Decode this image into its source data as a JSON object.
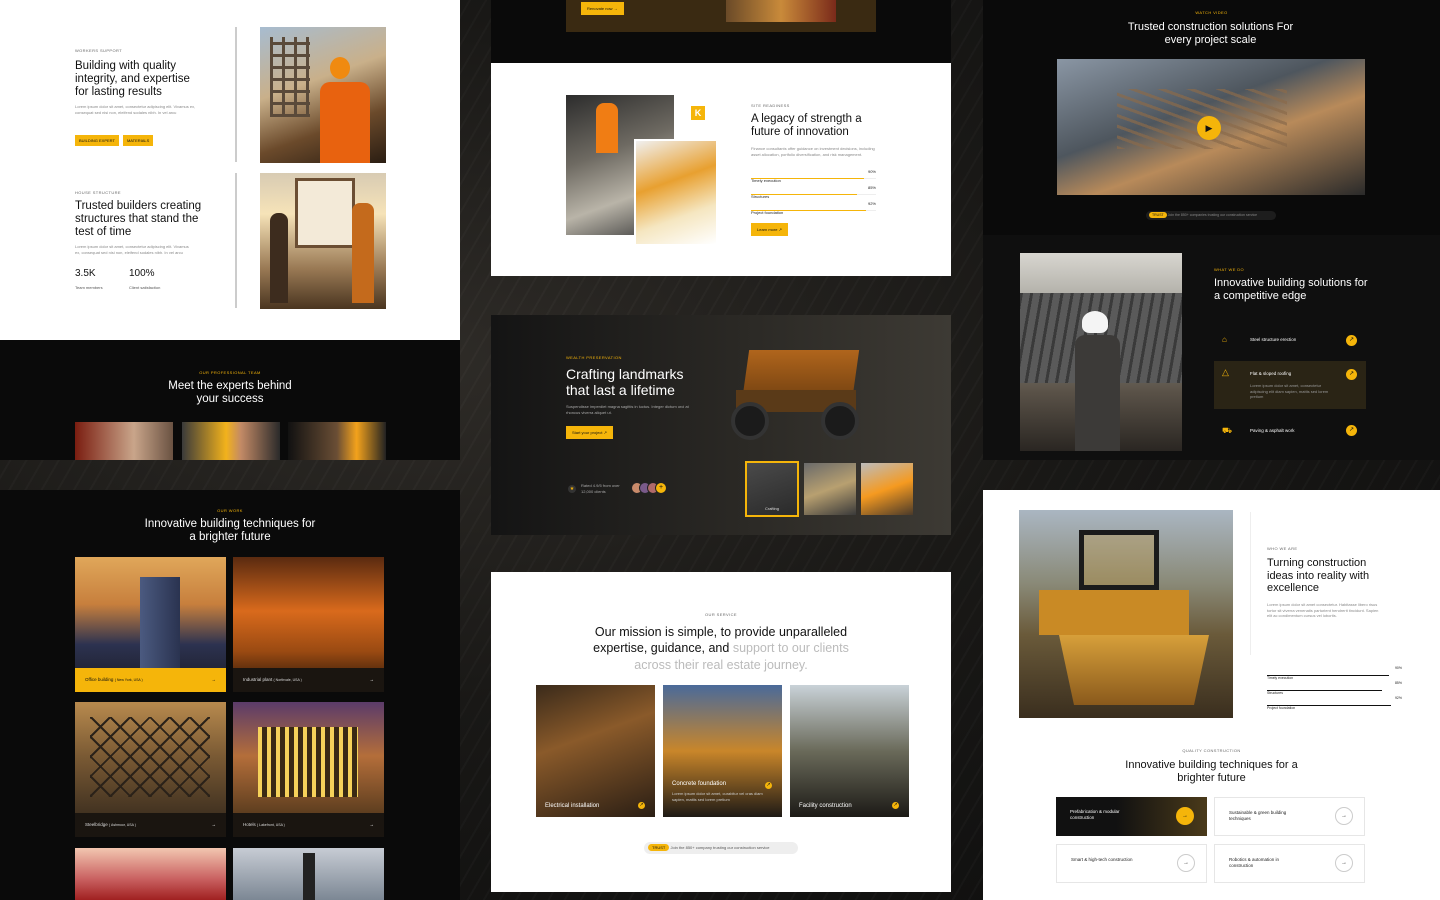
{
  "p1": {
    "tag1": "Workers support",
    "title1": "Building with quality integrity, and expertise for lasting results",
    "body1": "Lorem ipsum dolor sit amet, consectetur adipiscing elit. Vivamus ex, consequat sed nisi non, eleifend sodales nibh. In vel arcu",
    "chip1": "Building expert",
    "chip2": "Materials",
    "tag2": "House structure",
    "title2": "Trusted builders creating structures that stand the test of time",
    "body2": "Lorem ipsum dolor sit amet, consectetur adipiscing elit. Vivamus ex, consequat sed nisi non, eleifend sodales nibh. In vel arcu",
    "stat1_value": "3.5K",
    "stat1_label": "Team members",
    "stat2_value": "100%",
    "stat2_label": "Client satisfaction"
  },
  "p2": {
    "tag": "Our professional team",
    "title": "Meet the experts behind your success"
  },
  "p3": {
    "tag": "Our work",
    "title": "Innovative building techniques for a brighter future",
    "cards": [
      {
        "name": "Office building",
        "loc": "( New York, USA )",
        "arrow": "→"
      },
      {
        "name": "Industrial plant",
        "loc": "( Northvale, USA )",
        "arrow": "→"
      },
      {
        "name": "Steelbridge",
        "loc": "( Ashmoor, USA )",
        "arrow": "→"
      },
      {
        "name": "Hotels",
        "loc": "( Lakefront, USA )",
        "arrow": "→"
      }
    ]
  },
  "p4": {
    "btn": "Renovate now →"
  },
  "p5": {
    "logo": "K",
    "tag": "Site readiness",
    "title": "A legacy of strength a future of innovation",
    "body": "Finance consultants offer guidance on investment decisions, including asset allocation, portfolio diversification, and risk management.",
    "bars": [
      {
        "label": "Timely execution",
        "value": "90%"
      },
      {
        "label": "Structures",
        "value": "85%"
      },
      {
        "label": "Project foundation",
        "value": "92%"
      }
    ],
    "btn": "Learn more ↗"
  },
  "p6": {
    "tag": "Wealth preservation",
    "title": "Crafting landmarks that last a lifetime",
    "body": "Suspendisse imperdiet magna sagittis in luctus. Integer dictum orci at rhoncus viverra aliquet ut.",
    "btn": "Start your project ↗",
    "rating": "Rated 4.9/5 from over 12,000 clients",
    "thumb_label": "Crafting"
  },
  "p7": {
    "tag": "Our service",
    "title_dark": "Our mission is simple, to provide unparalleled expertise, guidance, and",
    "title_light": "support to our clients across their real estate journey.",
    "cards": [
      {
        "name": "Electrical installation"
      },
      {
        "name": "Concrete foundation",
        "body": "Lorem ipsum dolor sit amet, curabitur vel cras diam sapien, mattis sed lorem pretium"
      },
      {
        "name": "Facility construction"
      }
    ],
    "trust_badge": "Trust",
    "trust_text": "Join the 850+ company trusting our construction service"
  },
  "p8": {
    "tag": "Watch video",
    "title": "Trusted construction solutions For every project scale",
    "badge": "Trust",
    "badge_text": "Join the 850+ companies trusting our construction service"
  },
  "p9": {
    "tag": "What we do",
    "title": "Innovative building solutions for a competitive edge",
    "items": [
      {
        "name": "Steel structure erection"
      },
      {
        "name": "Flat & sloped roofing",
        "body": "Lorem ipsum dolor sit amet, consectetur adipiscing elit diam sapien, mattis sed lorem pretium"
      },
      {
        "name": "Paving & asphalt work"
      }
    ]
  },
  "p10": {
    "tag": "Who we are",
    "title": "Turning construction ideas into reality with excellence",
    "body": "Lorem ipsum dolor sit amet consectetur. Habitasse libero risus tortor sit viverra venenatis parturient hendrerit tincidunt. Sapien elit ac condimentum cursus vel lobortis.",
    "bars": [
      {
        "label": "Timely execution",
        "value": "90%"
      },
      {
        "label": "Structures",
        "value": "85%"
      },
      {
        "label": "Project foundation",
        "value": "92%"
      }
    ],
    "tag2": "Quality construction",
    "title2": "Innovative building techniques for a brighter future",
    "tiles": [
      {
        "name": "Prefabrication & modular construction"
      },
      {
        "name": "Sustainable & green building techniques"
      },
      {
        "name": "Smart & high-tech construction"
      },
      {
        "name": "Robotics & automation in construction"
      }
    ]
  }
}
